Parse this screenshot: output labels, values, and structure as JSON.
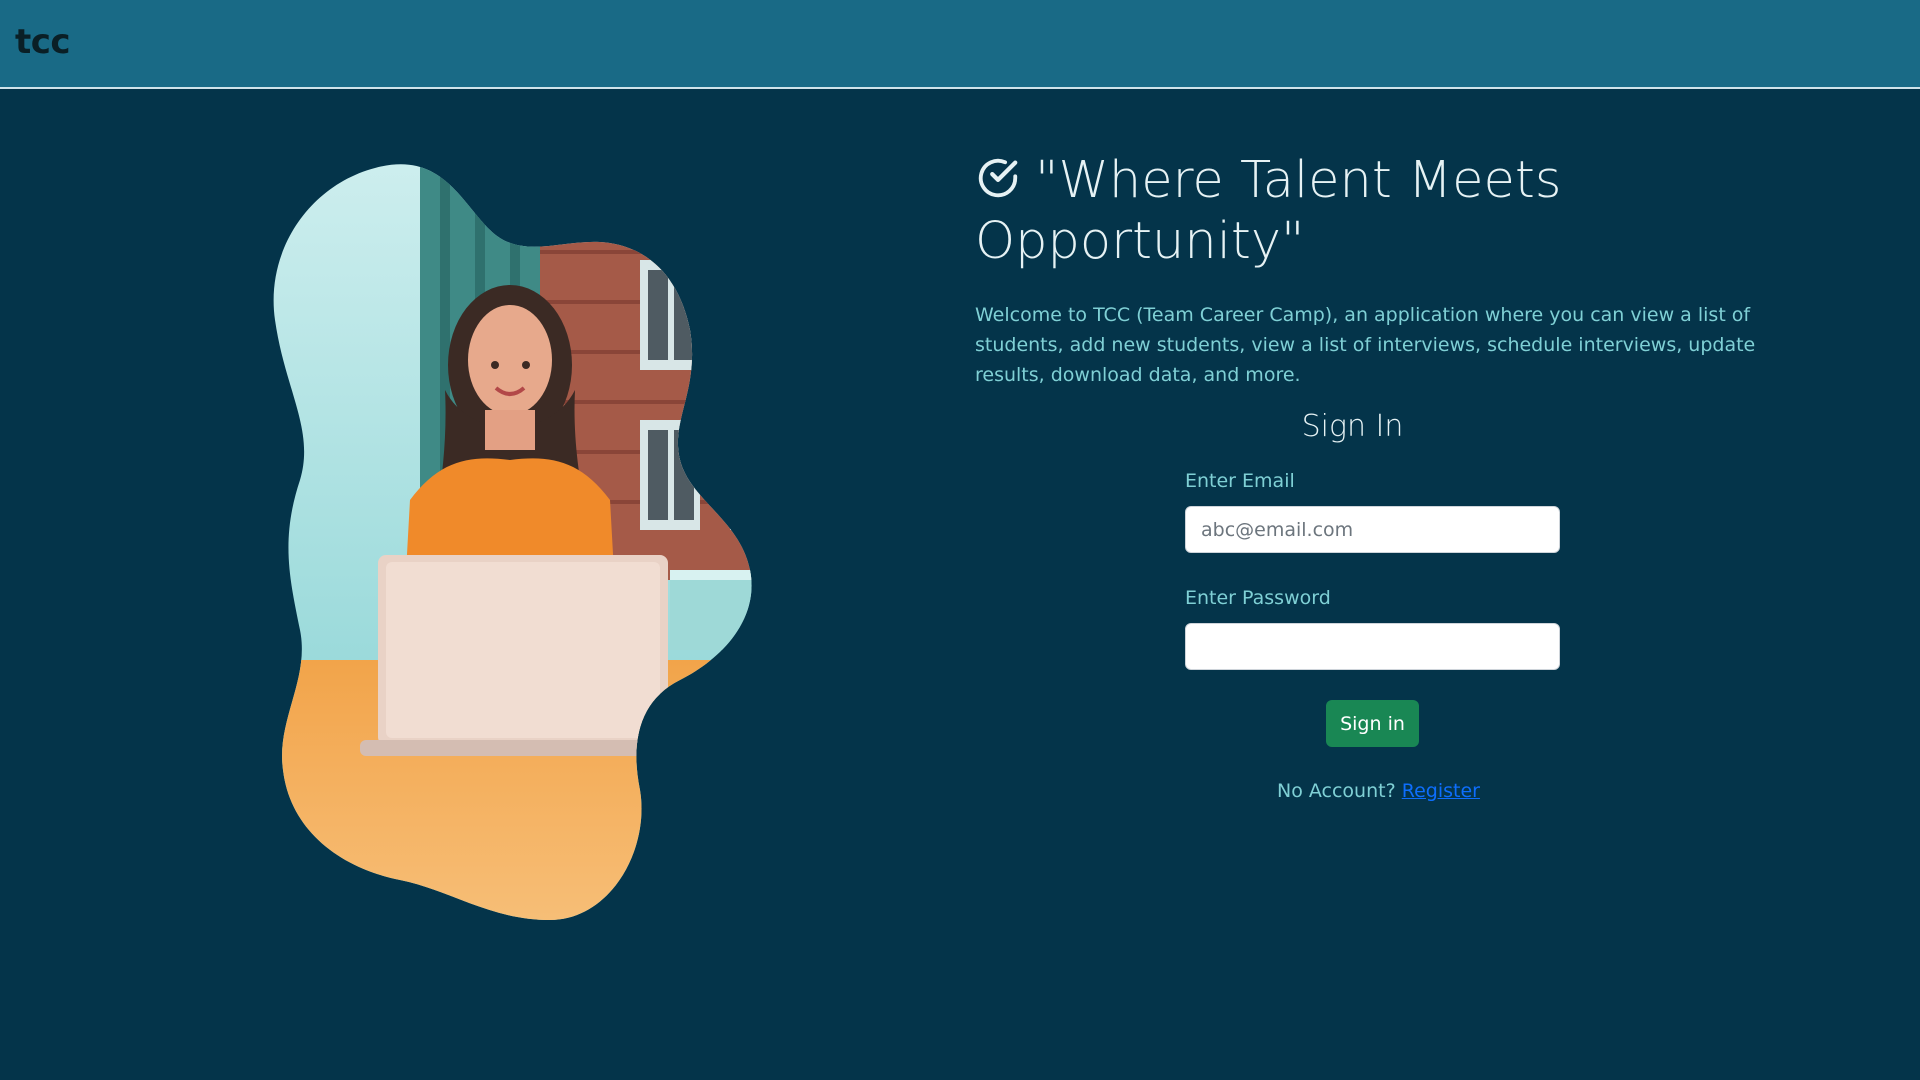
{
  "navbar": {
    "brand": "tcc",
    "color": "#196a86"
  },
  "hero": {
    "image_alt": "woman-laptop-illustration",
    "headline": "\"Where Talent Meets Opportunity\"",
    "intro": "Welcome to TCC (Team Career Camp), an application where you can view a list of students, add new students, view a list of interviews, schedule interviews, update results, download data, and more."
  },
  "signin": {
    "title": "Sign In",
    "email_label": "Enter Email",
    "email_placeholder": "abc@email.com",
    "email_value": "",
    "password_label": "Enter Password",
    "password_value": "",
    "submit_label": "Sign in",
    "no_account_text": "No Account?",
    "register_link": "Register"
  },
  "colors": {
    "background": "#04344a",
    "accent_text": "#7fd0d5",
    "button": "#198754",
    "link": "#0d6efd"
  }
}
